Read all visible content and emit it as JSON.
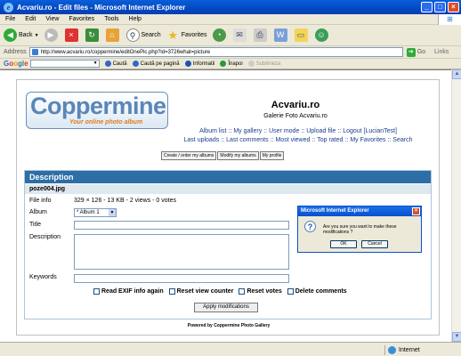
{
  "window": {
    "title": "Acvariu.ro - Edit files - Microsoft Internet Explorer"
  },
  "menu": {
    "items": [
      "File",
      "Edit",
      "View",
      "Favorites",
      "Tools",
      "Help"
    ]
  },
  "toolbar": {
    "back": "Back",
    "search": "Search",
    "favorites": "Favorites"
  },
  "address": {
    "label": "Address",
    "url": "http://www.acvariu.ro/coppermine/editOnePic.php?id=3726what=picture",
    "go": "Go",
    "links": "Links"
  },
  "googlebar": {
    "logo": "Google",
    "search_btn": "Caută",
    "search_page_btn": "Caută pe pagină",
    "info_btn": "Informatii",
    "back_btn": "Înapoi",
    "highlight_btn": "Sublinieza"
  },
  "site": {
    "logo_text": "Coppermine",
    "logo_subtitle": "Your online photo album",
    "title": "Acvariu.ro",
    "description": "Galerie Foto Acvariu.ro",
    "nav1": [
      "Album list",
      "My gallery",
      "User mode",
      "Upload file",
      "Logout [LucianTest]"
    ],
    "nav2": [
      "Last uploads",
      "Last comments",
      "Most viewed",
      "Top rated",
      "My Favorites",
      "Search"
    ],
    "nav_sep": "::",
    "buttons": [
      "Create / order my albums",
      "Modify my albums",
      "My profile"
    ]
  },
  "form": {
    "header": "Description",
    "filename": "poze004.jpg",
    "file_info_label": "File info",
    "file_info_value": "329 × 126 - 13 KB - 2 views - 0 votes",
    "album_label": "Album",
    "album_value": "* Album 1",
    "title_label": "Title",
    "description_label": "Description",
    "keywords_label": "Keywords",
    "checks": [
      "Read EXIF info again",
      "Reset view counter",
      "Reset votes",
      "Delete comments"
    ],
    "apply": "Apply modifications"
  },
  "footer": {
    "powered": "Powered by Coppermine Photo Gallery"
  },
  "dialog": {
    "title": "Microsoft Internet Explorer",
    "message": "Are you sure you want to make these modifications ?",
    "ok": "OK",
    "cancel": "Cancel"
  },
  "status": {
    "zone": "Internet"
  }
}
